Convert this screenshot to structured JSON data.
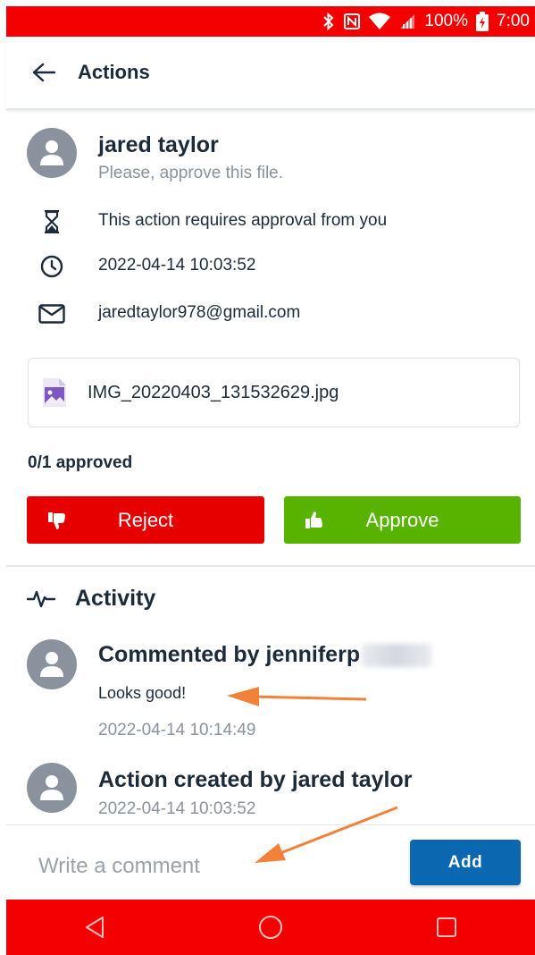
{
  "status_bar": {
    "battery": "100%",
    "time": "7:00",
    "icons": [
      "bluetooth-icon",
      "nfc-icon",
      "wifi-icon",
      "signal-icon",
      "battery-charging-icon"
    ]
  },
  "header": {
    "title": "Actions",
    "back_icon": "arrow-left-icon"
  },
  "request": {
    "requester_name": "jared taylor",
    "message": "Please, approve this file.",
    "requirement": "This action requires approval from you",
    "requirement_icon": "hourglass-icon",
    "timestamp": "2022-04-14 10:03:52",
    "timestamp_icon": "clock-icon",
    "email": "jaredtaylor978@gmail.com",
    "email_icon": "mail-icon"
  },
  "file": {
    "name": "IMG_20220403_131532629.jpg",
    "icon": "image-file-icon"
  },
  "approval": {
    "status": "0/1 approved",
    "reject_label": "Reject",
    "approve_label": "Approve",
    "reject_color": "#e60000",
    "approve_color": "#58b300"
  },
  "activity": {
    "title": "Activity",
    "items": [
      {
        "title": "Commented by jenniferp",
        "comment": "Looks good!",
        "timestamp": "2022-04-14 10:14:49"
      },
      {
        "title": "Action created by jared taylor",
        "timestamp": "2022-04-14 10:03:52"
      }
    ]
  },
  "comment_box": {
    "placeholder": "Write a comment",
    "value": "",
    "add_label": "Add",
    "add_color": "#0a67b0"
  },
  "nav_bar": {
    "buttons": [
      "back-triangle-icon",
      "home-circle-icon",
      "recents-square-icon"
    ],
    "color": "#f40000"
  }
}
